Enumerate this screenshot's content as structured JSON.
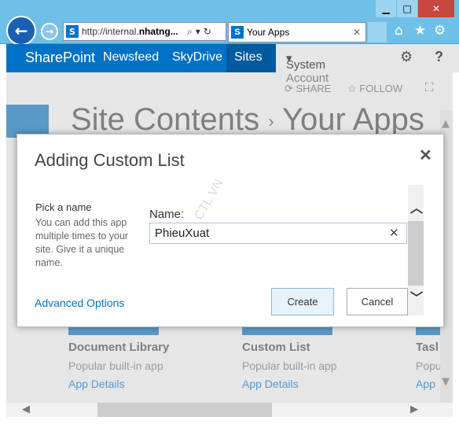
{
  "browser": {
    "address": "http://internal.",
    "address_bold": "nhatng...",
    "tab_title": "Your Apps",
    "sp_favicon": "S",
    "icons": [
      "back-arrow-icon",
      "forward-arrow-icon",
      "search-icon",
      "dropdown-icon",
      "refresh-icon",
      "home-icon",
      "star-icon",
      "gear-icon",
      "close-icon"
    ]
  },
  "sharepoint": {
    "brand": "SharePoint",
    "nav": [
      "Newsfeed",
      "SkyDrive",
      "Sites"
    ],
    "account": "System Account",
    "help": "?",
    "share": "SHARE",
    "follow": "FOLLOW",
    "page_title": "Site Contents",
    "page_title_sep": "›",
    "page_subtitle": "Your Apps",
    "accent": "#0072c6"
  },
  "cards": [
    {
      "title": "Document Library",
      "subtitle": "Popular built-in app",
      "link": "App Details"
    },
    {
      "title": "Custom List",
      "subtitle": "Popular built-in app",
      "link": "App Details"
    },
    {
      "title": "Tasl",
      "subtitle": "Popu",
      "link": "App"
    }
  ],
  "dialog": {
    "title": "Adding Custom List",
    "pick_title": "Pick a name",
    "pick_desc": "You can add this app multiple times to your site. Give it a unique name.",
    "name_label": "Name:",
    "name_value": "PhieuXuat",
    "advanced": "Advanced Options",
    "create": "Create",
    "cancel": "Cancel"
  },
  "watermark": "CTL.VN"
}
